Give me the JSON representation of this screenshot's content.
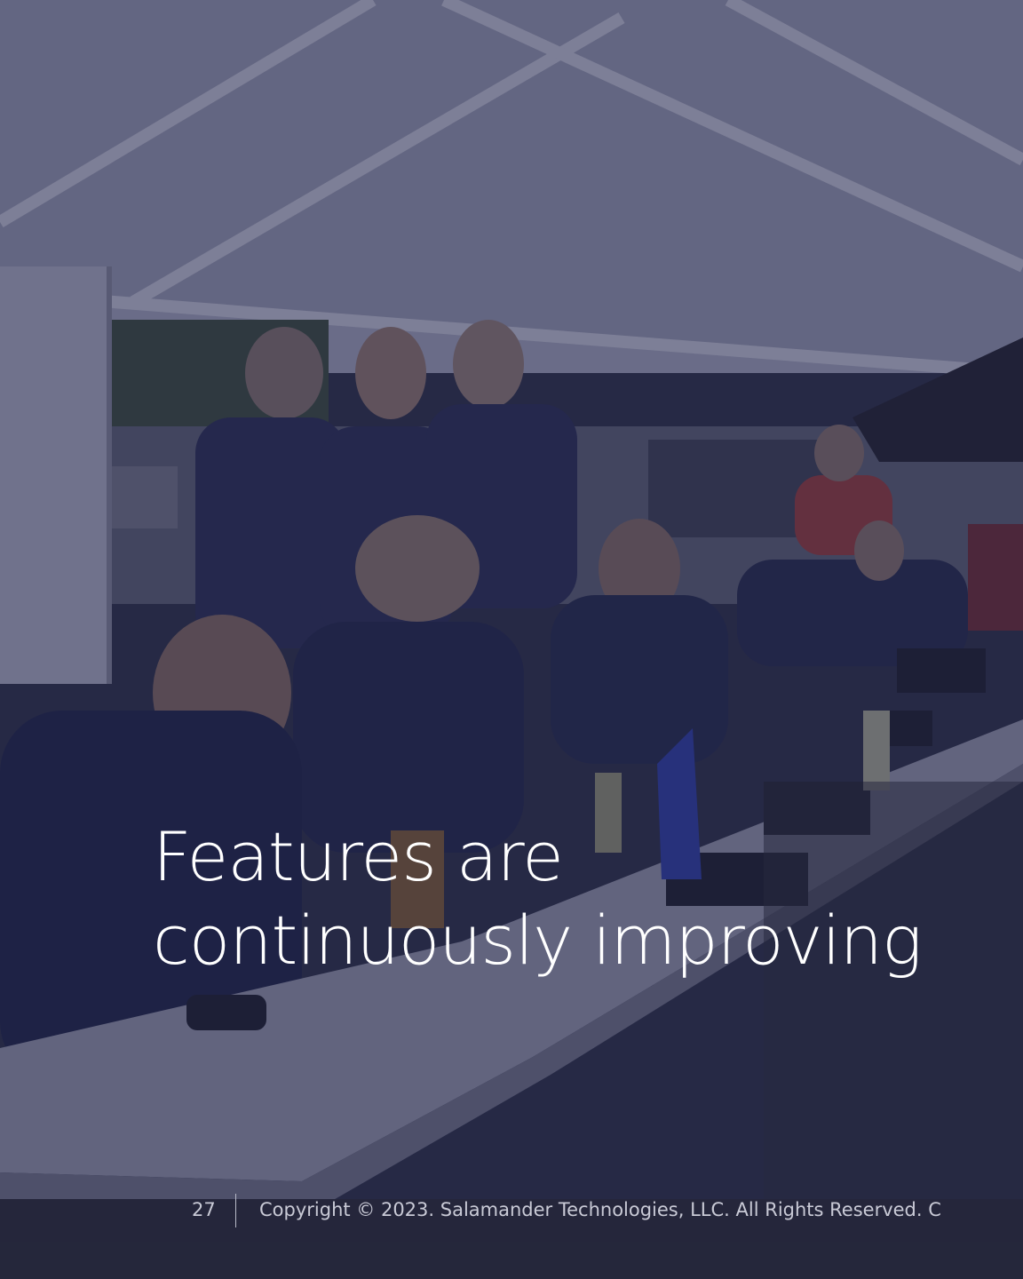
{
  "slide": {
    "title_line1": "Features are",
    "title_line2": "continuously improving",
    "page_number": "27",
    "copyright": "Copyright © 2023. Salamander Technologies, LLC.  All Rights Reserved.  C"
  },
  "colors": {
    "overlay": "#1e2046",
    "text": "#ffffff",
    "footer_text": "#c9cad6"
  }
}
